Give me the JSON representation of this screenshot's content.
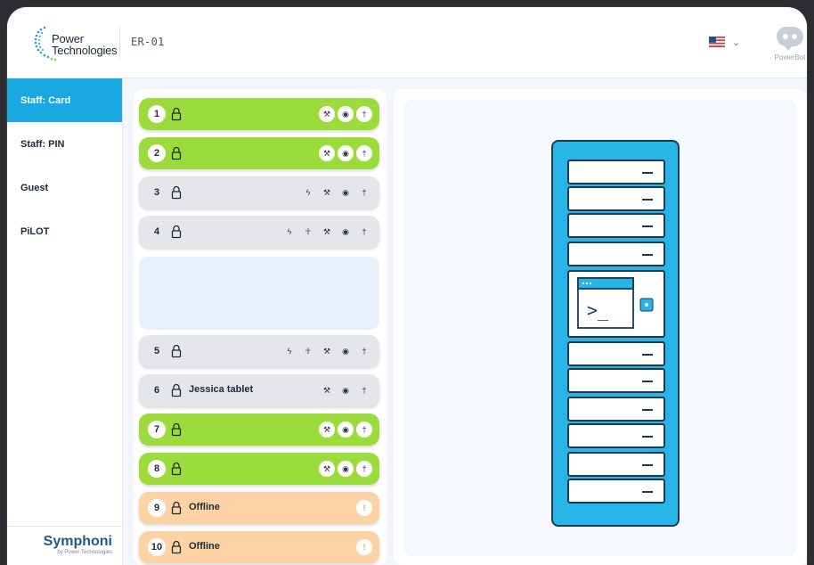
{
  "header": {
    "logo_line1": "Power",
    "logo_line2": "Technologies",
    "device_id": "ER-01",
    "language_icon": "us-flag-icon",
    "powerbot_label": "PowerBot"
  },
  "sidebar": {
    "items": [
      {
        "label": "Staff: Card",
        "active": true
      },
      {
        "label": "Staff: PIN",
        "active": false
      },
      {
        "label": "Guest",
        "active": false
      },
      {
        "label": "PiLOT",
        "active": false
      }
    ],
    "brand": "Symphoni",
    "brand_sub": "by Power Technologies"
  },
  "colors": {
    "accent": "#1aa8e0",
    "available": "#9bdc3c",
    "idle": "#e4e6ea",
    "offline": "#fdd2a4",
    "cabinet": "#27b5e8"
  },
  "drawers": [
    {
      "number": "1",
      "label": "",
      "status": "available",
      "icons": [
        "wrench-icon",
        "eye-icon",
        "person-icon"
      ]
    },
    {
      "number": "2",
      "label": "",
      "status": "available",
      "icons": [
        "wrench-icon",
        "eye-icon",
        "person-icon"
      ]
    },
    {
      "number": "3",
      "label": "",
      "status": "idle",
      "icons": [
        "bolt-icon",
        "wrench-icon",
        "eye-icon",
        "person-icon"
      ]
    },
    {
      "number": "4",
      "label": "",
      "status": "idle",
      "icons": [
        "bolt-icon",
        "figure-icon",
        "wrench-icon",
        "eye-icon",
        "person-icon"
      ]
    },
    {
      "number": "5",
      "label": "",
      "status": "idle",
      "icons": [
        "bolt-icon",
        "figure-icon",
        "wrench-icon",
        "eye-icon",
        "person-icon"
      ]
    },
    {
      "number": "6",
      "label": "Jessica tablet",
      "status": "idle",
      "icons": [
        "wrench-icon",
        "eye-icon",
        "person-icon"
      ]
    },
    {
      "number": "7",
      "label": "",
      "status": "available",
      "icons": [
        "wrench-icon",
        "eye-icon",
        "person-icon"
      ]
    },
    {
      "number": "8",
      "label": "",
      "status": "available",
      "icons": [
        "wrench-icon",
        "eye-icon",
        "person-icon"
      ]
    },
    {
      "number": "9",
      "label": "Offline",
      "status": "offline",
      "icons": [
        "alert-icon"
      ]
    },
    {
      "number": "10",
      "label": "Offline",
      "status": "offline",
      "icons": [
        "alert-icon"
      ]
    }
  ],
  "terminal": {
    "prompt": ">_"
  }
}
